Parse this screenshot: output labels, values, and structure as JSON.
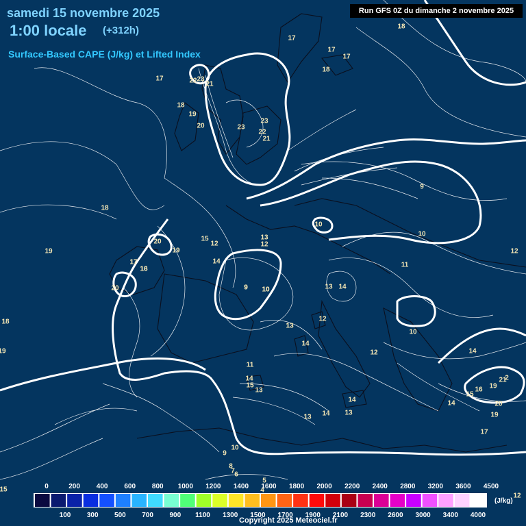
{
  "header": {
    "date": "samedi 15 novembre 2025",
    "time": "1:00 locale",
    "offset": "(+312h)",
    "parameter": "Surface-Based CAPE (J/kg) et Lifted Index",
    "run": "Run GFS 0Z du dimanche 2 novembre 2025"
  },
  "colors": {
    "sea_background": "#04355f",
    "contour": "#ffffff",
    "label": "#f4e6b4",
    "title": "#7fd3ff"
  },
  "lifted_index_labels": [
    "17",
    "17",
    "17",
    "18",
    "17",
    "18",
    "22",
    "23",
    "21",
    "23",
    "23",
    "22",
    "21",
    "18",
    "19",
    "20",
    "18",
    "17",
    "16",
    "15",
    "12",
    "13",
    "9",
    "10",
    "11",
    "12",
    "10",
    "10",
    "9",
    "12",
    "20",
    "19",
    "17",
    "18",
    "19",
    "20",
    "14",
    "9",
    "10",
    "13",
    "14",
    "13",
    "12",
    "11",
    "13",
    "14",
    "14",
    "15",
    "13",
    "12",
    "10",
    "14",
    "14",
    "14",
    "13",
    "13",
    "14",
    "15",
    "16",
    "19",
    "20",
    "21",
    "2",
    "19",
    "17",
    "9",
    "10",
    "8",
    "7",
    "6",
    "5",
    "4",
    "18",
    "19",
    "15",
    "12"
  ],
  "colorbar": {
    "top_ticks": [
      "0",
      "200",
      "400",
      "600",
      "800",
      "1000",
      "1200",
      "1400",
      "1600",
      "1800",
      "2000",
      "2200",
      "2400",
      "2800",
      "3200",
      "3600",
      "4500"
    ],
    "bottom_ticks": [
      "100",
      "300",
      "500",
      "700",
      "900",
      "1100",
      "1300",
      "1500",
      "1700",
      "1900",
      "2100",
      "2300",
      "2600",
      "3000",
      "3400",
      "4000"
    ],
    "unit": "(J/kg)",
    "colors": [
      "#0a0a40",
      "#0a1a70",
      "#0a22a8",
      "#0a2ee0",
      "#1450ff",
      "#1e80ff",
      "#28b4ff",
      "#40dcff",
      "#78ffd2",
      "#50ff78",
      "#a0ff28",
      "#dcff28",
      "#ffe628",
      "#ffbe1e",
      "#ff9614",
      "#ff6414",
      "#ff3214",
      "#ff0a0a",
      "#d2000a",
      "#aa0014",
      "#c80050",
      "#dc0096",
      "#e600c8",
      "#c800ff",
      "#f050ff",
      "#ffa0ff",
      "#ffd2ff",
      "#ffffff"
    ]
  },
  "footer": {
    "copyright": "Copyright 2025 Meteociel.fr"
  }
}
